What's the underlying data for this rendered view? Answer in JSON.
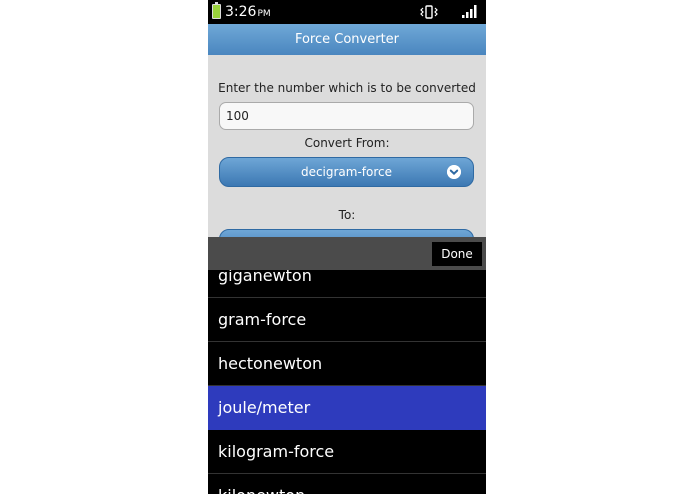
{
  "status_bar": {
    "time": "3:26",
    "ampm": "PM",
    "battery_color": "#9ad33c"
  },
  "header": {
    "title": "Force Converter"
  },
  "form": {
    "prompt": "Enter the number which is to be converted",
    "input_value": "100",
    "from_label": "Convert From:",
    "from_value": "decigram-force",
    "to_label": "To:",
    "to_value": ""
  },
  "picker": {
    "done_label": "Done",
    "items": [
      {
        "label": "giganewton",
        "selected": false
      },
      {
        "label": "gram-force",
        "selected": false
      },
      {
        "label": "hectonewton",
        "selected": false
      },
      {
        "label": "joule/meter",
        "selected": true
      },
      {
        "label": "kilogram-force",
        "selected": false
      },
      {
        "label": "kilonewton",
        "selected": false
      }
    ],
    "selected_color": "#2e3bbd"
  },
  "colors": {
    "header": "#4a86bf",
    "button": "#3c78b3"
  }
}
